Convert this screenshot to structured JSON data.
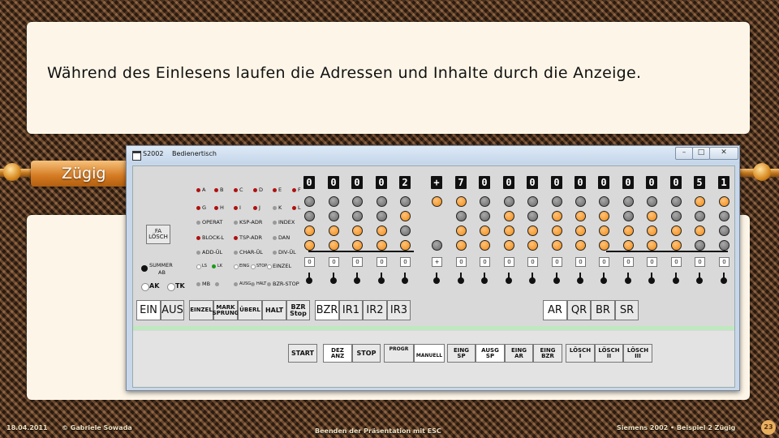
{
  "slide": {
    "headline": "Während des Einlesens laufen die Adressen und Inhalte durch die Anzeige.",
    "section_tab": "Zügig"
  },
  "window": {
    "title_app": "S2002",
    "title_name": "Bedienertisch",
    "buttons": [
      "–",
      "□",
      "✕"
    ]
  },
  "indicators": {
    "row1": [
      "A",
      "B",
      "C",
      "D",
      "E",
      "F"
    ],
    "row2": [
      "G",
      "H",
      "I",
      "J",
      "K",
      "L"
    ],
    "grey_labels": [
      [
        "OPERAT",
        "KSP-ADR",
        "INDEX"
      ],
      [
        "BLOCK-L",
        "TSP-ADR",
        "DAN"
      ],
      [
        "ADD-ÜL",
        "CHAR-ÜL",
        "DIV-ÜL"
      ]
    ],
    "ls": "LS",
    "lk": "LK",
    "eing": "EING",
    "stop": "STOP",
    "einzel": "EINZEL",
    "mb": "MB",
    "ausg": "AUSG",
    "halt": "HALT",
    "bzr_stop": "BZR-STOP"
  },
  "fa_losch": [
    "FA",
    "LÖSCH"
  ],
  "summer": [
    "SUMMER",
    "AB"
  ],
  "ak": "AK",
  "tk": "TK",
  "display": {
    "digits": [
      "0",
      "0",
      "0",
      "0",
      "2",
      "+",
      "7",
      "0",
      "0",
      "0",
      "0",
      "0",
      "0",
      "0",
      "0",
      "0",
      "5",
      "1"
    ],
    "switch_boxes": [
      "0",
      "0",
      "0",
      "0",
      "0",
      "+",
      "0",
      "0",
      "0",
      "0",
      "0",
      "0",
      "0",
      "0",
      "0",
      "0",
      "0",
      "0"
    ]
  },
  "row_buttons": {
    "ein": "EIN",
    "aus": "AUS",
    "einzel": "EINZEL",
    "mark_sprung": [
      "MARK",
      "SPRUNG"
    ],
    "uberl": "ÜBERL",
    "halt": "HALT",
    "bzr_stop": [
      "BZR",
      "Stop"
    ],
    "bzr": "BZR",
    "ir1": "IR1",
    "ir2": "IR2",
    "ir3": "IR3",
    "ar": "AR",
    "qr": "QR",
    "br": "BR",
    "sr": "SR"
  },
  "lower_buttons": {
    "start": "START",
    "dez_anz": [
      "DEZ",
      "ANZ"
    ],
    "stop": "STOP",
    "progr": "PROGR",
    "manuell": "MANUELL",
    "eing_sp": [
      "EING",
      "SP"
    ],
    "ausg_sp": [
      "AUSG",
      "SP"
    ],
    "eing_ar": [
      "EING",
      "AR"
    ],
    "eing_bzr": [
      "EING",
      "BZR"
    ],
    "losch_i": [
      "LÖSCH",
      "I"
    ],
    "losch_ii": [
      "LÖSCH",
      "II"
    ],
    "losch_iii": [
      "LÖSCH",
      "III"
    ]
  },
  "footer": {
    "date": "18.04.2011",
    "author": "© Gabriele Sowada",
    "hint": "Beenden der Präsentation mit ESC",
    "right": "Siemens 2002 • Beispiel 2 Zügig",
    "page": "23"
  }
}
